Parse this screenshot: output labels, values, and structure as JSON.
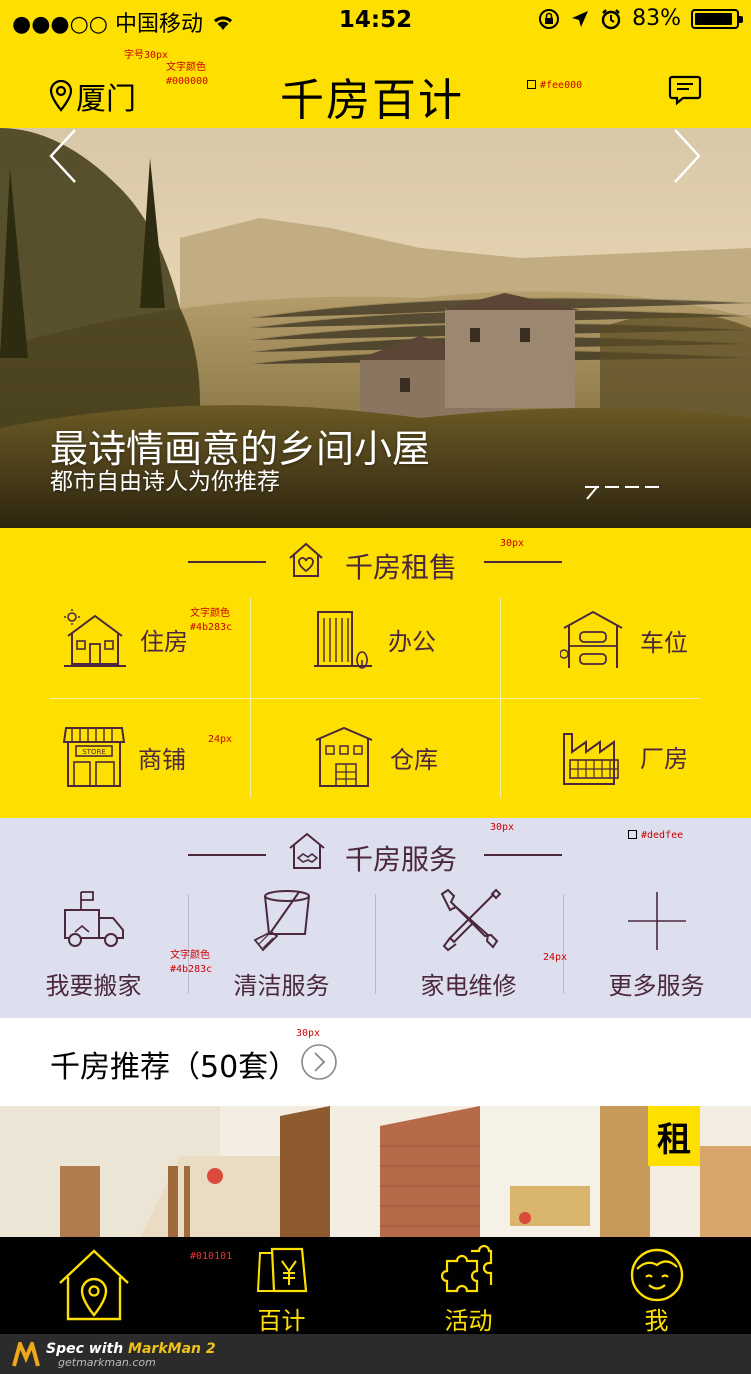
{
  "status": {
    "carrier": "●●●○○ 中国移动",
    "time": "14:52",
    "battery": "83%"
  },
  "header": {
    "city": "厦门",
    "logo": "千房百计"
  },
  "banner": {
    "title": "最诗情画意的乡间小屋",
    "subtitle": "都市自由诗人为你推荐",
    "active_slide": 4
  },
  "rental": {
    "title": "千房租售",
    "items": [
      {
        "label": "住房",
        "icon": "house-icon"
      },
      {
        "label": "办公",
        "icon": "office-building-icon"
      },
      {
        "label": "车位",
        "icon": "parking-garage-icon"
      },
      {
        "label": "商铺",
        "icon": "store-icon"
      },
      {
        "label": "仓库",
        "icon": "warehouse-icon"
      },
      {
        "label": "厂房",
        "icon": "factory-icon"
      }
    ]
  },
  "service": {
    "title": "千房服务",
    "items": [
      {
        "label": "我要搬家",
        "icon": "moving-truck-icon"
      },
      {
        "label": "清洁服务",
        "icon": "bucket-broom-icon"
      },
      {
        "label": "家电维修",
        "icon": "wrench-screwdriver-icon"
      },
      {
        "label": "更多服务",
        "icon": "plus-icon"
      }
    ]
  },
  "recommend": {
    "title": "千房推荐（50套）",
    "badge": "租"
  },
  "tabbar": {
    "items": [
      {
        "label": "",
        "icon": "home-location-icon"
      },
      {
        "label": "百计",
        "icon": "yen-cards-icon"
      },
      {
        "label": "活动",
        "icon": "puzzle-icon"
      },
      {
        "label": "我",
        "icon": "smiley-face-icon"
      }
    ]
  },
  "annotations": {
    "a1": "字号30px",
    "a2": "文字颜色",
    "a3": "#000000",
    "a4": "#fee000",
    "a5": "30px",
    "a6": "文字颜色",
    "a7": "#4b283c",
    "a8": "24px",
    "a9": "30px",
    "a10": "#dedfee",
    "a11": "文字颜色",
    "a12": "#4b283c",
    "a13": "24px",
    "a14": "30px",
    "a15": "#010101"
  },
  "footer": {
    "brand_prefix": "Spec with ",
    "brand": "MarkMan 2",
    "site": "getmarkman.com"
  },
  "colors": {
    "yellow": "#fee000",
    "text": "#4b283c",
    "service_bg": "#dedfee",
    "tabbar": "#010101"
  }
}
